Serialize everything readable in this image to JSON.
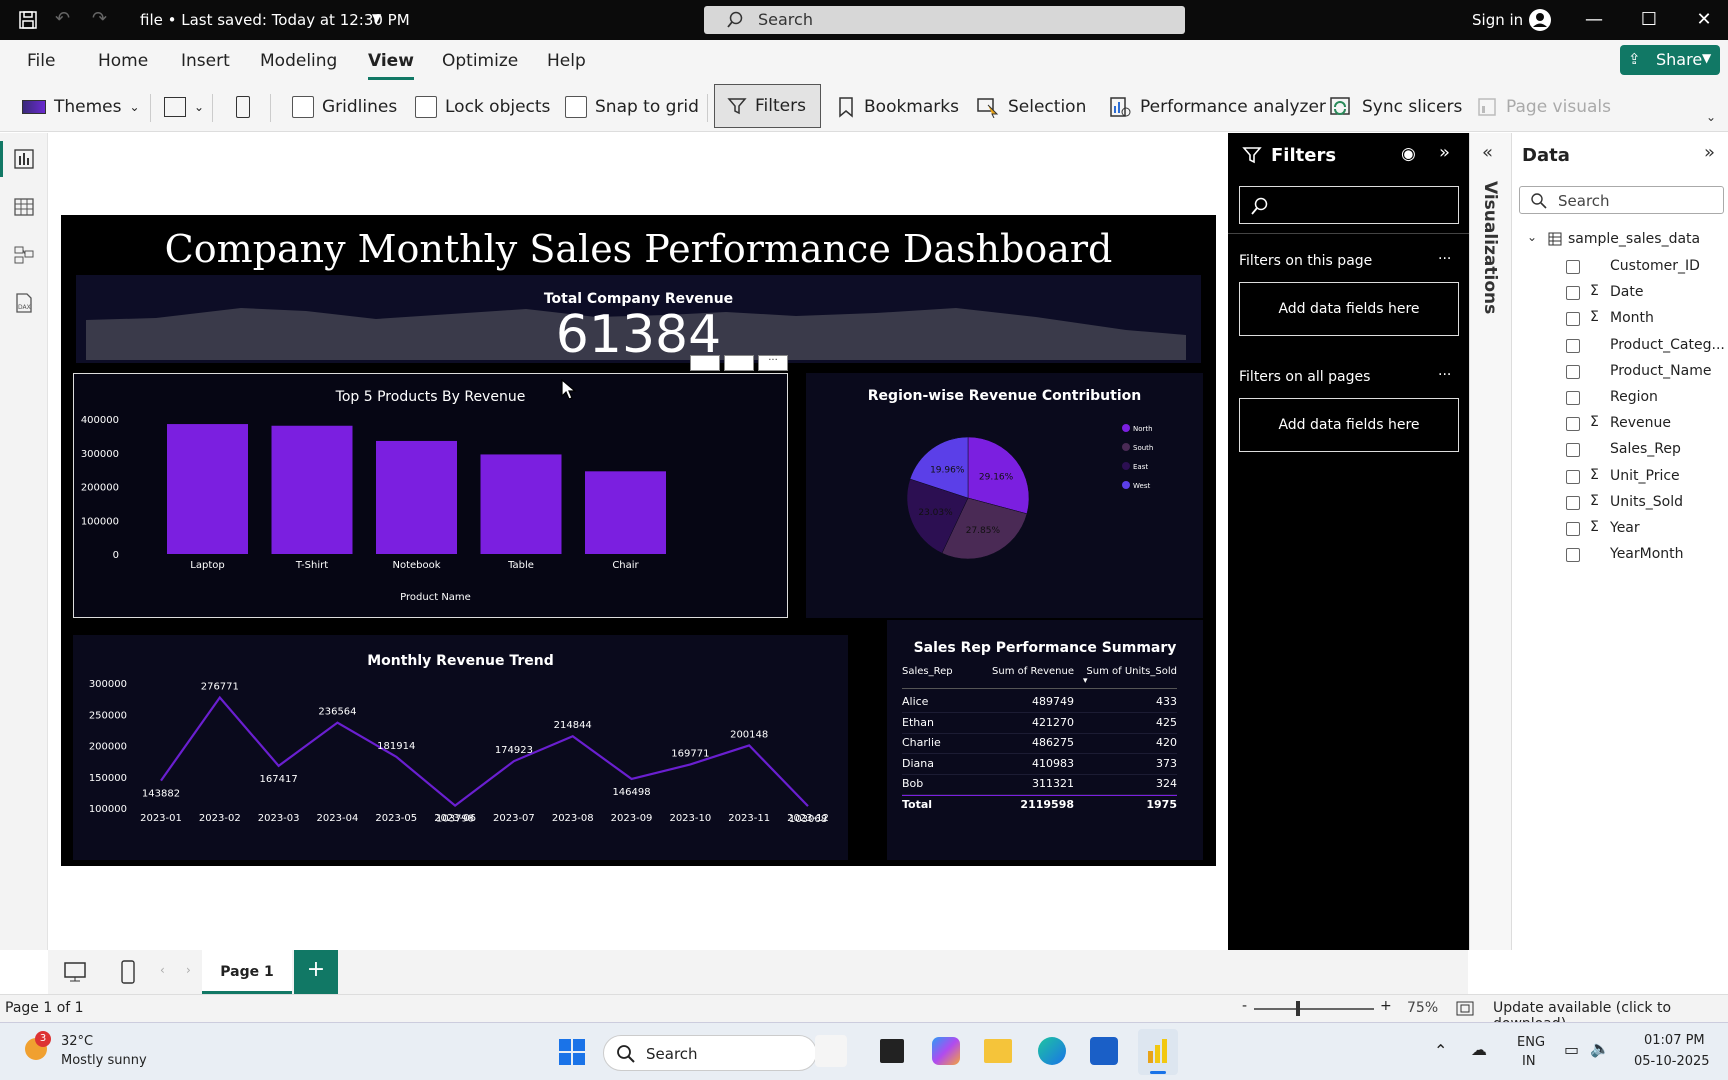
{
  "window": {
    "file_title": "file • Last saved: Today at 12:30 PM",
    "search_placeholder": "Search",
    "sign_in": "Sign in"
  },
  "menu": [
    "File",
    "Home",
    "Insert",
    "Modeling",
    "View",
    "Optimize",
    "Help"
  ],
  "share_label": "Share",
  "ribbon": {
    "themes": "Themes",
    "gridlines": "Gridlines",
    "lock_objects": "Lock objects",
    "snap_to_grid": "Snap to grid",
    "filters": "Filters",
    "bookmarks": "Bookmarks",
    "selection": "Selection",
    "performance_analyzer": "Performance analyzer",
    "sync_slicers": "Sync slicers",
    "page_visuals": "Page visuals"
  },
  "dashboard": {
    "title": "Company Monthly Sales Performance Dashboard",
    "kpi_label": "Total Company Revenue",
    "kpi_value": "61384",
    "bar_title": "Top 5 Products By Revenue",
    "bar_xlabel": "Product Name",
    "pie_title": "Region-wise Revenue Contribution",
    "line_title": "Monthly Revenue Trend",
    "table_title": "Sales Rep Performance Summary"
  },
  "chart_data": [
    {
      "type": "bar",
      "title": "Top 5 Products By Revenue",
      "xlabel": "Product Name",
      "ylabel": "",
      "categories": [
        "Laptop",
        "T-Shirt",
        "Notebook",
        "Table",
        "Chair"
      ],
      "values": [
        385000,
        380000,
        335000,
        295000,
        245000
      ],
      "yticks": [
        0,
        100000,
        200000,
        300000,
        400000
      ],
      "ylim": [
        0,
        400000
      ],
      "color": "#7b1fe0"
    },
    {
      "type": "pie",
      "title": "Region-wise Revenue Contribution",
      "labels": [
        "North",
        "South",
        "East",
        "West"
      ],
      "values": [
        29.16,
        27.85,
        23.03,
        19.96
      ],
      "display_labels": [
        "29.16%",
        "27.85%",
        "23.03%",
        "19.96%"
      ],
      "colors": [
        "#7b1fe0",
        "#4a2a55",
        "#2c0f52",
        "#5b3fe8"
      ],
      "legend_position": "right"
    },
    {
      "type": "line",
      "title": "Monthly Revenue Trend",
      "x": [
        "2023-01",
        "2023-02",
        "2023-03",
        "2023-04",
        "2023-05",
        "2023-06",
        "2023-07",
        "2023-08",
        "2023-09",
        "2023-10",
        "2023-11",
        "2023-12"
      ],
      "values": [
        143882,
        276771,
        167417,
        236564,
        181914,
        103798,
        174923,
        214844,
        146498,
        169771,
        200148,
        103068
      ],
      "yticks": [
        100000,
        150000,
        200000,
        250000,
        300000
      ],
      "ylim": [
        100000,
        300000
      ],
      "color": "#6a1fd0"
    }
  ],
  "table": {
    "headers": [
      "Sales_Rep",
      "Sum of Revenue",
      "Sum of Units_Sold"
    ],
    "rows": [
      [
        "Alice",
        "489749",
        "433"
      ],
      [
        "Ethan",
        "421270",
        "425"
      ],
      [
        "Charlie",
        "486275",
        "420"
      ],
      [
        "Diana",
        "410983",
        "373"
      ],
      [
        "Bob",
        "311321",
        "324"
      ]
    ],
    "total": [
      "Total",
      "2119598",
      "1975"
    ]
  },
  "filters": {
    "title": "Filters",
    "on_this_page": "Filters on this page",
    "on_all_pages": "Filters on all pages",
    "add_fields": "Add data fields here",
    "more": "···"
  },
  "visualizations_label": "Visualizations",
  "data_pane": {
    "title": "Data",
    "search_placeholder": "Search",
    "table_name": "sample_sales_data",
    "fields": [
      {
        "name": "Customer_ID",
        "sigma": ""
      },
      {
        "name": "Date",
        "sigma": "Σ"
      },
      {
        "name": "Month",
        "sigma": "Σ"
      },
      {
        "name": "Product_Categ...",
        "sigma": ""
      },
      {
        "name": "Product_Name",
        "sigma": ""
      },
      {
        "name": "Region",
        "sigma": ""
      },
      {
        "name": "Revenue",
        "sigma": "Σ"
      },
      {
        "name": "Sales_Rep",
        "sigma": ""
      },
      {
        "name": "Unit_Price",
        "sigma": "Σ"
      },
      {
        "name": "Units_Sold",
        "sigma": "Σ"
      },
      {
        "name": "Year",
        "sigma": "Σ"
      },
      {
        "name": "YearMonth",
        "sigma": ""
      }
    ]
  },
  "pages": {
    "page1": "Page 1",
    "add": "+"
  },
  "status": {
    "page_count": "Page 1 of 1",
    "zoom_minus": "-",
    "zoom_plus": "+",
    "zoom": "75%",
    "update": "Update available (click to download)"
  },
  "taskbar": {
    "weather_temp": "32°C",
    "weather_desc": "Mostly sunny",
    "weather_badge": "3",
    "search": "Search",
    "lang1": "ENG",
    "lang2": "IN",
    "time": "01:07 PM",
    "date": "05-10-2025"
  },
  "colors": {
    "accent": "#117865",
    "bar": "#7b1fe0",
    "line": "#6a1fd0",
    "report_bg": "#000000"
  }
}
